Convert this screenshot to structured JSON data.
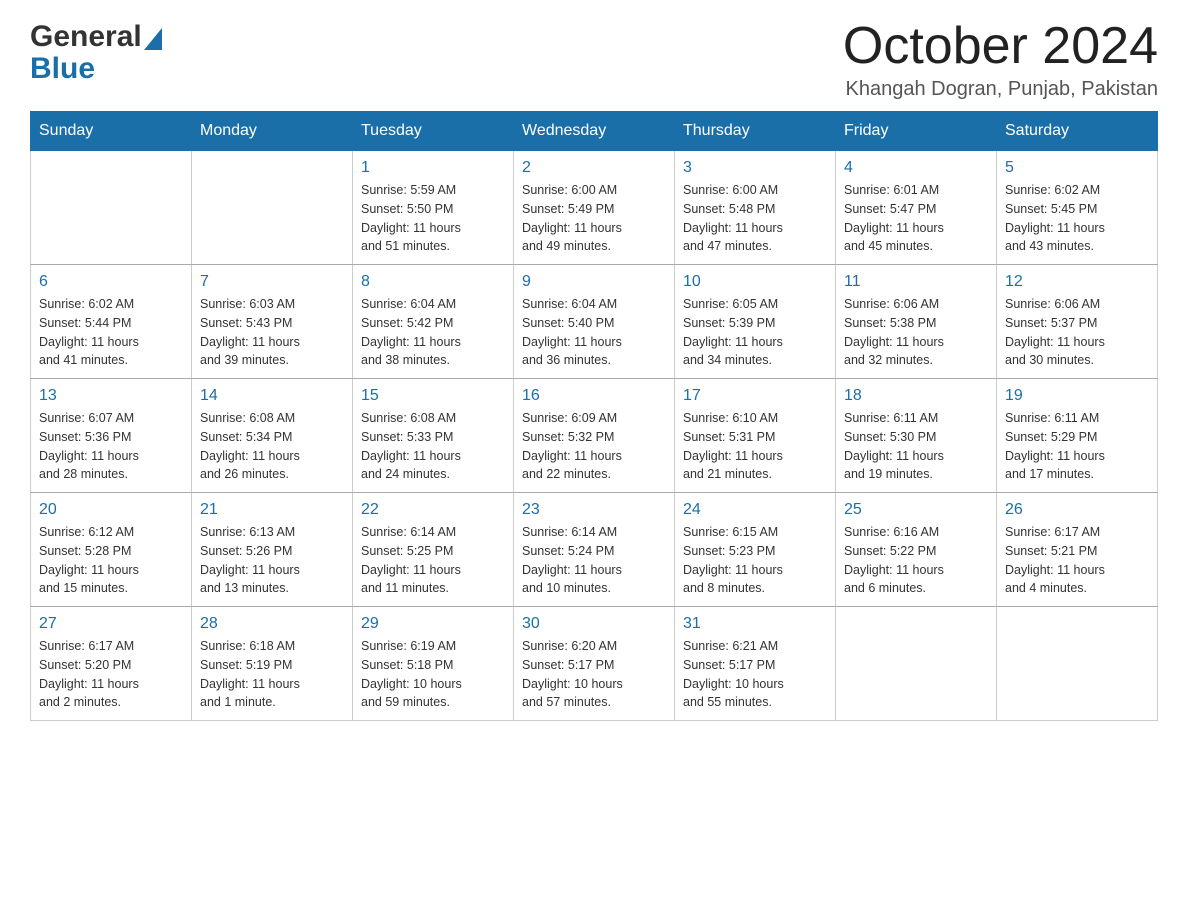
{
  "header": {
    "month_title": "October 2024",
    "location": "Khangah Dogran, Punjab, Pakistan",
    "logo_general": "General",
    "logo_blue": "Blue"
  },
  "days_of_week": [
    "Sunday",
    "Monday",
    "Tuesday",
    "Wednesday",
    "Thursday",
    "Friday",
    "Saturday"
  ],
  "weeks": [
    [
      {
        "day": "",
        "info": ""
      },
      {
        "day": "",
        "info": ""
      },
      {
        "day": "1",
        "info": "Sunrise: 5:59 AM\nSunset: 5:50 PM\nDaylight: 11 hours\nand 51 minutes."
      },
      {
        "day": "2",
        "info": "Sunrise: 6:00 AM\nSunset: 5:49 PM\nDaylight: 11 hours\nand 49 minutes."
      },
      {
        "day": "3",
        "info": "Sunrise: 6:00 AM\nSunset: 5:48 PM\nDaylight: 11 hours\nand 47 minutes."
      },
      {
        "day": "4",
        "info": "Sunrise: 6:01 AM\nSunset: 5:47 PM\nDaylight: 11 hours\nand 45 minutes."
      },
      {
        "day": "5",
        "info": "Sunrise: 6:02 AM\nSunset: 5:45 PM\nDaylight: 11 hours\nand 43 minutes."
      }
    ],
    [
      {
        "day": "6",
        "info": "Sunrise: 6:02 AM\nSunset: 5:44 PM\nDaylight: 11 hours\nand 41 minutes."
      },
      {
        "day": "7",
        "info": "Sunrise: 6:03 AM\nSunset: 5:43 PM\nDaylight: 11 hours\nand 39 minutes."
      },
      {
        "day": "8",
        "info": "Sunrise: 6:04 AM\nSunset: 5:42 PM\nDaylight: 11 hours\nand 38 minutes."
      },
      {
        "day": "9",
        "info": "Sunrise: 6:04 AM\nSunset: 5:40 PM\nDaylight: 11 hours\nand 36 minutes."
      },
      {
        "day": "10",
        "info": "Sunrise: 6:05 AM\nSunset: 5:39 PM\nDaylight: 11 hours\nand 34 minutes."
      },
      {
        "day": "11",
        "info": "Sunrise: 6:06 AM\nSunset: 5:38 PM\nDaylight: 11 hours\nand 32 minutes."
      },
      {
        "day": "12",
        "info": "Sunrise: 6:06 AM\nSunset: 5:37 PM\nDaylight: 11 hours\nand 30 minutes."
      }
    ],
    [
      {
        "day": "13",
        "info": "Sunrise: 6:07 AM\nSunset: 5:36 PM\nDaylight: 11 hours\nand 28 minutes."
      },
      {
        "day": "14",
        "info": "Sunrise: 6:08 AM\nSunset: 5:34 PM\nDaylight: 11 hours\nand 26 minutes."
      },
      {
        "day": "15",
        "info": "Sunrise: 6:08 AM\nSunset: 5:33 PM\nDaylight: 11 hours\nand 24 minutes."
      },
      {
        "day": "16",
        "info": "Sunrise: 6:09 AM\nSunset: 5:32 PM\nDaylight: 11 hours\nand 22 minutes."
      },
      {
        "day": "17",
        "info": "Sunrise: 6:10 AM\nSunset: 5:31 PM\nDaylight: 11 hours\nand 21 minutes."
      },
      {
        "day": "18",
        "info": "Sunrise: 6:11 AM\nSunset: 5:30 PM\nDaylight: 11 hours\nand 19 minutes."
      },
      {
        "day": "19",
        "info": "Sunrise: 6:11 AM\nSunset: 5:29 PM\nDaylight: 11 hours\nand 17 minutes."
      }
    ],
    [
      {
        "day": "20",
        "info": "Sunrise: 6:12 AM\nSunset: 5:28 PM\nDaylight: 11 hours\nand 15 minutes."
      },
      {
        "day": "21",
        "info": "Sunrise: 6:13 AM\nSunset: 5:26 PM\nDaylight: 11 hours\nand 13 minutes."
      },
      {
        "day": "22",
        "info": "Sunrise: 6:14 AM\nSunset: 5:25 PM\nDaylight: 11 hours\nand 11 minutes."
      },
      {
        "day": "23",
        "info": "Sunrise: 6:14 AM\nSunset: 5:24 PM\nDaylight: 11 hours\nand 10 minutes."
      },
      {
        "day": "24",
        "info": "Sunrise: 6:15 AM\nSunset: 5:23 PM\nDaylight: 11 hours\nand 8 minutes."
      },
      {
        "day": "25",
        "info": "Sunrise: 6:16 AM\nSunset: 5:22 PM\nDaylight: 11 hours\nand 6 minutes."
      },
      {
        "day": "26",
        "info": "Sunrise: 6:17 AM\nSunset: 5:21 PM\nDaylight: 11 hours\nand 4 minutes."
      }
    ],
    [
      {
        "day": "27",
        "info": "Sunrise: 6:17 AM\nSunset: 5:20 PM\nDaylight: 11 hours\nand 2 minutes."
      },
      {
        "day": "28",
        "info": "Sunrise: 6:18 AM\nSunset: 5:19 PM\nDaylight: 11 hours\nand 1 minute."
      },
      {
        "day": "29",
        "info": "Sunrise: 6:19 AM\nSunset: 5:18 PM\nDaylight: 10 hours\nand 59 minutes."
      },
      {
        "day": "30",
        "info": "Sunrise: 6:20 AM\nSunset: 5:17 PM\nDaylight: 10 hours\nand 57 minutes."
      },
      {
        "day": "31",
        "info": "Sunrise: 6:21 AM\nSunset: 5:17 PM\nDaylight: 10 hours\nand 55 minutes."
      },
      {
        "day": "",
        "info": ""
      },
      {
        "day": "",
        "info": ""
      }
    ]
  ]
}
